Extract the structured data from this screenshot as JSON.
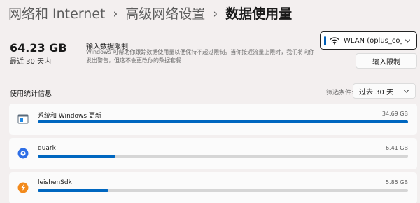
{
  "breadcrumb": {
    "items": [
      "网络和 Internet",
      "高级网络设置"
    ],
    "current": "数据使用量"
  },
  "summary": {
    "total": "64.23 GB",
    "caption": "最近 30 天内"
  },
  "limit": {
    "title": "输入数据限制",
    "description": "Windows 可帮助你跟踪数据使用量以便保持不超过限制。当你接近流量上限时，我们将向你发出警告，但这不会更改你的数据套餐",
    "button_label": "输入限制"
  },
  "network": {
    "selected": "WLAN (oplus_co_ap",
    "icon": "wifi-icon",
    "accent_color": "#005fb8"
  },
  "usage": {
    "title": "使用统计信息",
    "filter_label": "筛选条件:",
    "filter_value": "过去 30 天"
  },
  "apps": [
    {
      "name": "系统和 Windows 更新",
      "size": "34.69 GB",
      "usage_fraction": 1.0,
      "icon": "windows-settings-icon"
    },
    {
      "name": "quark",
      "size": "6.41 GB",
      "usage_fraction": 0.21,
      "icon": "quark-icon"
    },
    {
      "name": "leishenSdk",
      "size": "5.85 GB",
      "usage_fraction": 0.19,
      "icon": "leishen-icon"
    }
  ],
  "colors": {
    "accent": "#0067c0",
    "background": "#f3efef",
    "card": "#fbfbfb"
  }
}
